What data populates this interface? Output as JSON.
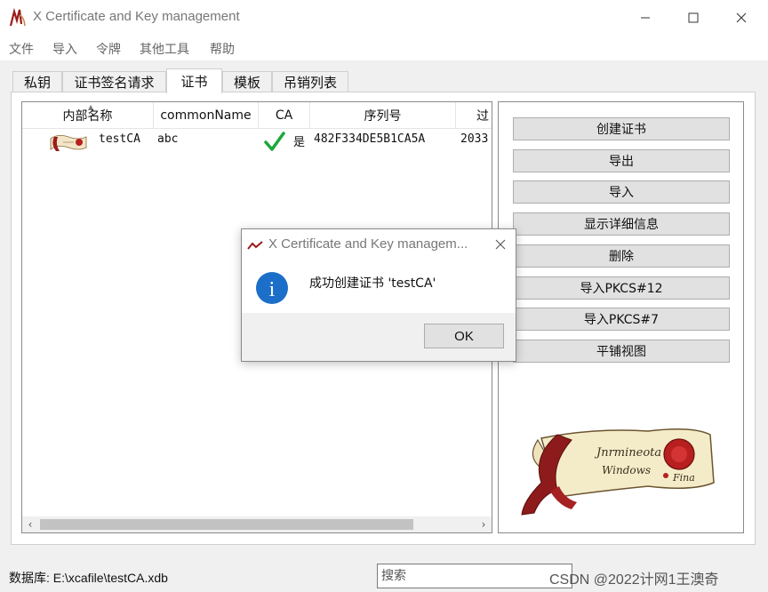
{
  "window": {
    "title": "X Certificate and Key management",
    "controls": {
      "minimize": "—",
      "maximize": "☐",
      "close": "✕"
    }
  },
  "menu": [
    "文件",
    "导入",
    "令牌",
    "其他工具",
    "帮助"
  ],
  "tabs": [
    "私钥",
    "证书签名请求",
    "证书",
    "模板",
    "吊销列表"
  ],
  "active_tab": "证书",
  "cert_list": {
    "columns": [
      "内部名称",
      "commonName",
      "CA",
      "序列号",
      "过"
    ],
    "rows": [
      {
        "internal_name": "testCA",
        "common_name": "abc",
        "ca": "是",
        "serial": "482F334DE5B1CA5A",
        "expiry": "2033"
      }
    ]
  },
  "side_buttons": [
    "创建证书",
    "导出",
    "导入",
    "显示详细信息",
    "删除",
    "导入PKCS#12",
    "导入PKCS#7",
    "平铺视图"
  ],
  "logo_text": {
    "line1": "Jnrmineota",
    "line2": "Windows",
    "line3": "Fina"
  },
  "status": {
    "db_label": "数据库: E:\\xcafile\\testCA.xdb",
    "search_placeholder": "搜索"
  },
  "watermark": "CSDN @2022计网1王澳奇",
  "dialog": {
    "title": "X Certificate and Key managem...",
    "message": "成功创建证书 'testCA'",
    "ok_label": "OK",
    "info_glyph": "i"
  },
  "colors": {
    "accent_info": "#1b6fc8",
    "check_green": "#1aa83a",
    "logo_red": "#9b1b1b"
  },
  "icons": [
    "app-logo-icon",
    "minimize-icon",
    "maximize-icon",
    "close-icon",
    "certificate-icon",
    "checkmark-icon",
    "info-icon",
    "scroll-left-icon",
    "scroll-right-icon"
  ]
}
